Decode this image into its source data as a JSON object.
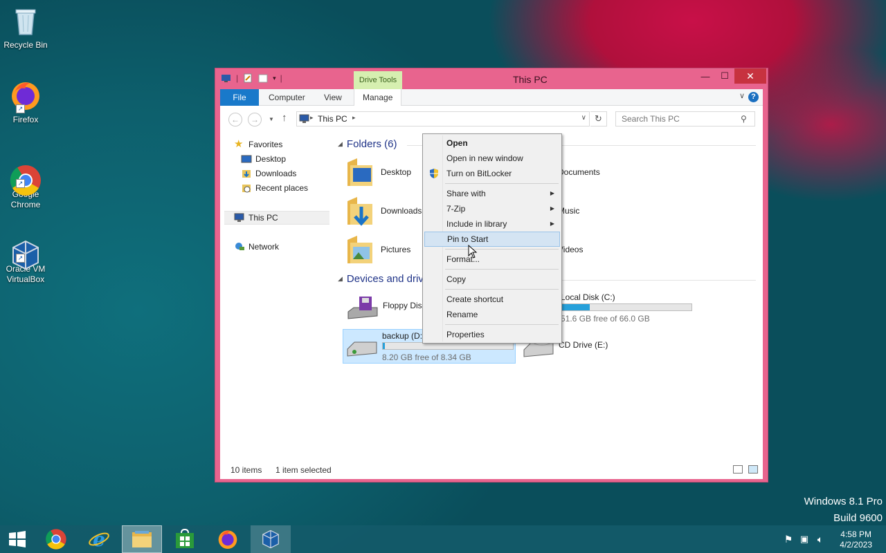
{
  "desktop": {
    "icons": [
      {
        "label": "Recycle Bin"
      },
      {
        "label": "Firefox"
      },
      {
        "label": "Google\nChrome"
      },
      {
        "label": "Oracle VM\nVirtualBox"
      }
    ]
  },
  "window": {
    "title": "This PC",
    "context_tab": "Drive Tools",
    "tabs": [
      "File",
      "Computer",
      "View",
      "Manage"
    ],
    "address": {
      "crumb": "This PC"
    },
    "search": {
      "placeholder": "Search This PC"
    },
    "nav_pane": {
      "favorites": "Favorites",
      "desktop": "Desktop",
      "downloads": "Downloads",
      "recent": "Recent places",
      "this_pc": "This PC",
      "network": "Network"
    },
    "folders_header": "Folders (6)",
    "folders": [
      "Desktop",
      "Downloads",
      "Pictures",
      "Documents",
      "Music",
      "Videos"
    ],
    "devices_header": "Devices and drives (4)",
    "drives": {
      "floppy": {
        "name": "Floppy Disk Drive (A:)"
      },
      "backup": {
        "name": "backup (D:)",
        "free": "8.20 GB free of 8.34 GB",
        "used_fraction": 0.017
      },
      "local": {
        "name": "Local Disk (C:)",
        "free": "51.6 GB free of 66.0 GB",
        "used_fraction": 0.22
      },
      "cd": {
        "name": "CD Drive (E:)"
      }
    },
    "status": {
      "items": "10 items",
      "selected": "1 item selected"
    }
  },
  "context_menu": {
    "open": "Open",
    "open_new": "Open in new window",
    "bitlocker": "Turn on BitLocker",
    "share": "Share with",
    "zip": "7-Zip",
    "library": "Include in library",
    "pin": "Pin to Start",
    "format": "Format...",
    "copy": "Copy",
    "shortcut": "Create shortcut",
    "rename": "Rename",
    "properties": "Properties"
  },
  "watermark": {
    "line1": "Windows 8.1 Pro",
    "line2": "Build 9600"
  },
  "clock": {
    "time": "4:58 PM",
    "date": "4/2/2023"
  },
  "colors": {
    "window_border": "#e8648e",
    "accent": "#1979ca",
    "selection": "#cce8ff"
  }
}
